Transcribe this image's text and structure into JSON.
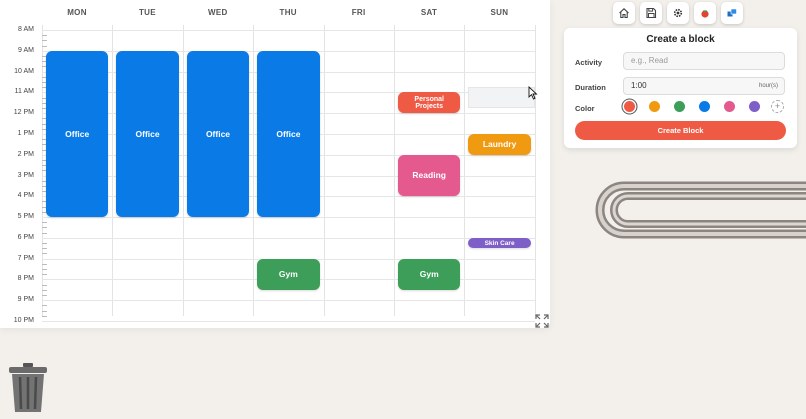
{
  "calendar": {
    "days": [
      "MON",
      "TUE",
      "WED",
      "THU",
      "FRI",
      "SAT",
      "SUN"
    ],
    "hours": [
      "8 AM",
      "9 AM",
      "10 AM",
      "11 AM",
      "12 PM",
      "1 PM",
      "2 PM",
      "3 PM",
      "4 PM",
      "5 PM",
      "6 PM",
      "7 PM",
      "8 PM",
      "9 PM",
      "10 PM"
    ],
    "events": [
      {
        "label": "Office",
        "day": 0,
        "start": 9,
        "end": 17,
        "color": "#0a7be6"
      },
      {
        "label": "Office",
        "day": 1,
        "start": 9,
        "end": 17,
        "color": "#0a7be6"
      },
      {
        "label": "Office",
        "day": 2,
        "start": 9,
        "end": 17,
        "color": "#0a7be6"
      },
      {
        "label": "Office",
        "day": 3,
        "start": 9,
        "end": 17,
        "color": "#0a7be6"
      },
      {
        "label": "Gym",
        "day": 3,
        "start": 19,
        "end": 20.5,
        "color": "#3d9e5a"
      },
      {
        "label": "Personal Projects",
        "day": 5,
        "start": 11,
        "end": 12,
        "color": "#ef5a45"
      },
      {
        "label": "Reading",
        "day": 5,
        "start": 14,
        "end": 16,
        "color": "#e45a8e"
      },
      {
        "label": "Gym",
        "day": 5,
        "start": 19,
        "end": 20.5,
        "color": "#3d9e5a"
      },
      {
        "label": "Laundry",
        "day": 6,
        "start": 13,
        "end": 14,
        "color": "#f09a11"
      },
      {
        "label": "Skin Care",
        "day": 6,
        "start": 18,
        "end": 18.5,
        "color": "#7e5ec7"
      }
    ]
  },
  "toolbar": {
    "icons": [
      "home-icon",
      "save-icon",
      "gear-icon",
      "tomato-icon",
      "windows-icon"
    ]
  },
  "panel": {
    "title": "Create a block",
    "activity_label": "Activity",
    "activity_placeholder": "e.g., Read",
    "duration_label": "Duration",
    "duration_value": "1:00",
    "duration_unit": "hour(s)",
    "color_label": "Color",
    "colors": [
      "#ef5a45",
      "#f09a11",
      "#3d9e5a",
      "#0a7be6",
      "#e45a8e",
      "#7e5ec7"
    ],
    "selected_color": 0,
    "add_color": "+",
    "create_label": "Create Block"
  }
}
